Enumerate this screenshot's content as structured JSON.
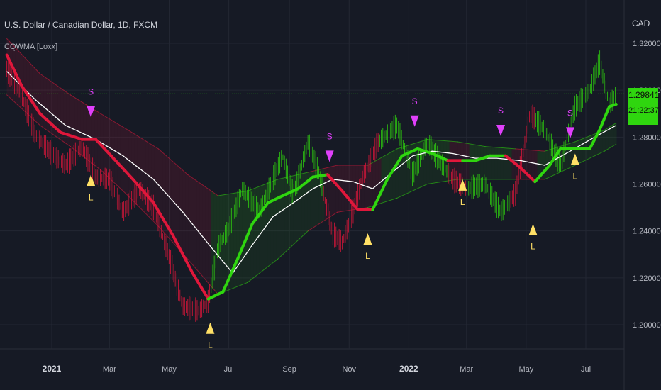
{
  "header": {
    "symbol_title": "U.S. Dollar / Canadian Dollar, 1D, FXCM",
    "indicator_label": "CQWMA [Loxx]",
    "currency": "CAD"
  },
  "price_tag": {
    "price": "1.29841",
    "countdown": "21:22:37",
    "color": "#2fd60f"
  },
  "colors": {
    "background": "#161a25",
    "bull": "#2fd60f",
    "bear": "#e0173b",
    "signal_long": "#ffe066",
    "signal_short": "#e040fb",
    "baseline": "#ffffff"
  },
  "chart_data": {
    "type": "line",
    "title": "U.S. Dollar / Canadian Dollar, 1D, FXCM",
    "ylabel": "CAD",
    "xlabel": "",
    "ylim": [
      1.19,
      1.33
    ],
    "yticks": [
      {
        "value": 1.32,
        "label": "1.32000"
      },
      {
        "value": 1.3,
        "label": "1.30000"
      },
      {
        "value": 1.28,
        "label": "1.28000"
      },
      {
        "value": 1.26,
        "label": "1.26000"
      },
      {
        "value": 1.24,
        "label": "1.24000"
      },
      {
        "value": 1.22,
        "label": "1.22000"
      },
      {
        "value": 1.2,
        "label": "1.20000"
      }
    ],
    "xticks": [
      {
        "date": "2021-01-01",
        "label": "2021"
      },
      {
        "date": "2021-03-01",
        "label": "Mar"
      },
      {
        "date": "2021-05-01",
        "label": "May"
      },
      {
        "date": "2021-07-01",
        "label": "Jul"
      },
      {
        "date": "2021-09-01",
        "label": "Sep"
      },
      {
        "date": "2021-11-01",
        "label": "Nov"
      },
      {
        "date": "2022-01-01",
        "label": "2022"
      },
      {
        "date": "2022-03-01",
        "label": "Mar"
      },
      {
        "date": "2022-05-01",
        "label": "May"
      },
      {
        "date": "2022-07-01",
        "label": "Jul"
      }
    ],
    "current_price": 1.29841,
    "grid": true,
    "legend": "none",
    "series": [
      {
        "role": "cqwma",
        "points": [
          [
            "2020-11-16",
            1.315
          ],
          [
            "2020-12-01",
            1.302
          ],
          [
            "2020-12-20",
            1.29
          ],
          [
            "2021-01-10",
            1.282
          ],
          [
            "2021-02-01",
            1.279
          ],
          [
            "2021-02-15",
            1.279
          ],
          [
            "2021-03-05",
            1.271
          ],
          [
            "2021-03-25",
            1.262
          ],
          [
            "2021-04-15",
            1.252
          ],
          [
            "2021-05-05",
            1.238
          ],
          [
            "2021-05-25",
            1.222
          ],
          [
            "2021-06-10",
            1.211
          ],
          [
            "2021-06-25",
            1.214
          ],
          [
            "2021-07-10",
            1.228
          ],
          [
            "2021-07-25",
            1.243
          ],
          [
            "2021-08-10",
            1.252
          ],
          [
            "2021-08-25",
            1.255
          ],
          [
            "2021-09-10",
            1.258
          ],
          [
            "2021-09-25",
            1.263
          ],
          [
            "2021-10-10",
            1.264
          ],
          [
            "2021-10-25",
            1.257
          ],
          [
            "2021-11-10",
            1.249
          ],
          [
            "2021-11-25",
            1.249
          ],
          [
            "2021-12-10",
            1.262
          ],
          [
            "2021-12-25",
            1.272
          ],
          [
            "2022-01-10",
            1.275
          ],
          [
            "2022-01-25",
            1.273
          ],
          [
            "2022-02-10",
            1.27
          ],
          [
            "2022-02-25",
            1.27
          ],
          [
            "2022-03-10",
            1.27
          ],
          [
            "2022-03-25",
            1.272
          ],
          [
            "2022-04-10",
            1.272
          ],
          [
            "2022-04-25",
            1.267
          ],
          [
            "2022-05-10",
            1.261
          ],
          [
            "2022-05-25",
            1.268
          ],
          [
            "2022-06-05",
            1.275
          ],
          [
            "2022-06-25",
            1.275
          ],
          [
            "2022-07-05",
            1.275
          ],
          [
            "2022-07-15",
            1.283
          ],
          [
            "2022-07-25",
            1.293
          ],
          [
            "2022-08-01",
            1.294
          ]
        ],
        "bull_from": [
          "2021-06-12",
          "2021-12-02",
          "2022-03-01",
          "2022-05-10"
        ],
        "bear_from": [
          "2020-11-16",
          "2021-10-05",
          "2022-02-10",
          "2022-04-15"
        ]
      },
      {
        "role": "baseline",
        "points": [
          [
            "2020-11-16",
            1.308
          ],
          [
            "2020-12-15",
            1.296
          ],
          [
            "2021-01-15",
            1.285
          ],
          [
            "2021-02-15",
            1.279
          ],
          [
            "2021-03-15",
            1.272
          ],
          [
            "2021-04-15",
            1.262
          ],
          [
            "2021-05-15",
            1.248
          ],
          [
            "2021-06-15",
            1.232
          ],
          [
            "2021-07-05",
            1.222
          ],
          [
            "2021-07-25",
            1.234
          ],
          [
            "2021-08-15",
            1.246
          ],
          [
            "2021-09-05",
            1.252
          ],
          [
            "2021-09-25",
            1.258
          ],
          [
            "2021-10-15",
            1.262
          ],
          [
            "2021-11-05",
            1.261
          ],
          [
            "2021-11-25",
            1.258
          ],
          [
            "2021-12-15",
            1.265
          ],
          [
            "2022-01-05",
            1.272
          ],
          [
            "2022-01-25",
            1.274
          ],
          [
            "2022-02-15",
            1.273
          ],
          [
            "2022-03-10",
            1.271
          ],
          [
            "2022-04-01",
            1.271
          ],
          [
            "2022-04-25",
            1.27
          ],
          [
            "2022-05-20",
            1.268
          ],
          [
            "2022-06-15",
            1.274
          ],
          [
            "2022-07-10",
            1.28
          ],
          [
            "2022-08-01",
            1.285
          ]
        ]
      },
      {
        "role": "upper_band",
        "points": [
          [
            "2020-11-16",
            1.322
          ],
          [
            "2020-12-20",
            1.307
          ],
          [
            "2021-01-20",
            1.298
          ],
          [
            "2021-02-20",
            1.29
          ],
          [
            "2021-03-20",
            1.283
          ],
          [
            "2021-04-20",
            1.275
          ],
          [
            "2021-05-20",
            1.264
          ],
          [
            "2021-06-20",
            1.255
          ],
          [
            "2021-07-20",
            1.257
          ],
          [
            "2021-08-20",
            1.262
          ],
          [
            "2021-09-20",
            1.265
          ],
          [
            "2021-10-20",
            1.268
          ],
          [
            "2021-11-20",
            1.268
          ],
          [
            "2021-12-20",
            1.275
          ],
          [
            "2022-01-20",
            1.279
          ],
          [
            "2022-02-20",
            1.278
          ],
          [
            "2022-03-20",
            1.276
          ],
          [
            "2022-04-20",
            1.275
          ],
          [
            "2022-05-20",
            1.274
          ],
          [
            "2022-06-20",
            1.278
          ],
          [
            "2022-07-20",
            1.283
          ],
          [
            "2022-08-01",
            1.286
          ]
        ]
      },
      {
        "role": "lower_band",
        "points": [
          [
            "2020-11-16",
            1.298
          ],
          [
            "2020-12-20",
            1.285
          ],
          [
            "2021-01-20",
            1.276
          ],
          [
            "2021-02-20",
            1.266
          ],
          [
            "2021-03-20",
            1.255
          ],
          [
            "2021-04-20",
            1.242
          ],
          [
            "2021-05-20",
            1.228
          ],
          [
            "2021-06-20",
            1.213
          ],
          [
            "2021-07-20",
            1.218
          ],
          [
            "2021-08-20",
            1.228
          ],
          [
            "2021-09-20",
            1.24
          ],
          [
            "2021-10-20",
            1.248
          ],
          [
            "2021-11-20",
            1.25
          ],
          [
            "2021-12-20",
            1.254
          ],
          [
            "2022-01-20",
            1.26
          ],
          [
            "2022-02-20",
            1.262
          ],
          [
            "2022-03-20",
            1.262
          ],
          [
            "2022-04-20",
            1.262
          ],
          [
            "2022-05-20",
            1.262
          ],
          [
            "2022-06-20",
            1.268
          ],
          [
            "2022-07-20",
            1.274
          ],
          [
            "2022-08-01",
            1.277
          ]
        ]
      },
      {
        "role": "price",
        "points": [
          [
            "2020-11-16",
            1.309
          ],
          [
            "2020-12-01",
            1.298
          ],
          [
            "2020-12-15",
            1.281
          ],
          [
            "2021-01-01",
            1.273
          ],
          [
            "2021-01-15",
            1.268
          ],
          [
            "2021-02-01",
            1.276
          ],
          [
            "2021-02-15",
            1.263
          ],
          [
            "2021-03-01",
            1.262
          ],
          [
            "2021-03-15",
            1.248
          ],
          [
            "2021-04-01",
            1.258
          ],
          [
            "2021-04-15",
            1.25
          ],
          [
            "2021-05-01",
            1.229
          ],
          [
            "2021-05-15",
            1.208
          ],
          [
            "2021-06-01",
            1.206
          ],
          [
            "2021-06-10",
            1.21
          ],
          [
            "2021-06-20",
            1.233
          ],
          [
            "2021-07-01",
            1.241
          ],
          [
            "2021-07-15",
            1.258
          ],
          [
            "2021-08-01",
            1.248
          ],
          [
            "2021-08-15",
            1.262
          ],
          [
            "2021-08-25",
            1.272
          ],
          [
            "2021-09-05",
            1.255
          ],
          [
            "2021-09-20",
            1.278
          ],
          [
            "2021-10-01",
            1.265
          ],
          [
            "2021-10-15",
            1.239
          ],
          [
            "2021-10-25",
            1.235
          ],
          [
            "2021-11-05",
            1.248
          ],
          [
            "2021-11-15",
            1.263
          ],
          [
            "2021-12-01",
            1.278
          ],
          [
            "2021-12-20",
            1.285
          ],
          [
            "2022-01-05",
            1.264
          ],
          [
            "2022-01-20",
            1.278
          ],
          [
            "2022-02-01",
            1.27
          ],
          [
            "2022-02-15",
            1.262
          ],
          [
            "2022-03-01",
            1.258
          ],
          [
            "2022-03-20",
            1.26
          ],
          [
            "2022-04-05",
            1.248
          ],
          [
            "2022-04-20",
            1.256
          ],
          [
            "2022-05-05",
            1.29
          ],
          [
            "2022-05-20",
            1.283
          ],
          [
            "2022-06-05",
            1.268
          ],
          [
            "2022-06-20",
            1.293
          ],
          [
            "2022-07-05",
            1.3
          ],
          [
            "2022-07-15",
            1.312
          ],
          [
            "2022-07-25",
            1.294
          ],
          [
            "2022-08-01",
            1.298
          ]
        ]
      }
    ],
    "signals": [
      {
        "type": "S",
        "date": "2021-02-10",
        "value": 1.289
      },
      {
        "type": "L",
        "date": "2021-02-10",
        "value": 1.264
      },
      {
        "type": "L",
        "date": "2021-06-12",
        "value": 1.201
      },
      {
        "type": "S",
        "date": "2021-10-12",
        "value": 1.27
      },
      {
        "type": "L",
        "date": "2021-11-20",
        "value": 1.239
      },
      {
        "type": "S",
        "date": "2022-01-07",
        "value": 1.285
      },
      {
        "type": "L",
        "date": "2022-02-25",
        "value": 1.262
      },
      {
        "type": "S",
        "date": "2022-04-05",
        "value": 1.281
      },
      {
        "type": "L",
        "date": "2022-05-08",
        "value": 1.243
      },
      {
        "type": "S",
        "date": "2022-06-15",
        "value": 1.28
      },
      {
        "type": "L",
        "date": "2022-06-20",
        "value": 1.273
      }
    ]
  }
}
